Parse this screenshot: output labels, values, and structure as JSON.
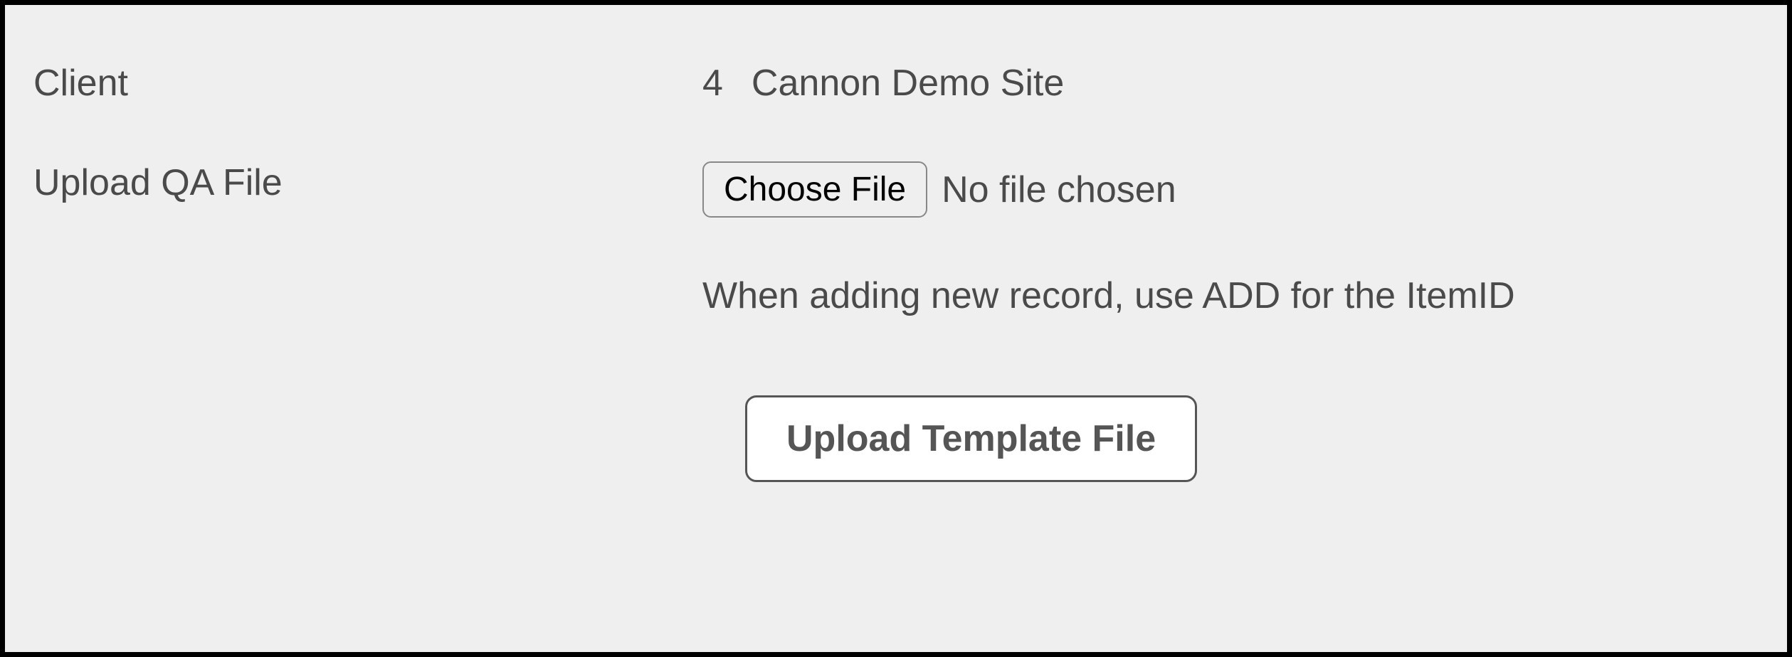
{
  "form": {
    "client_label": "Client",
    "client_id": "4",
    "client_name": "Cannon Demo Site",
    "upload_label": "Upload QA File",
    "choose_file_button": "Choose File",
    "file_status": "No file chosen",
    "hint": "When adding new record, use ADD for the ItemID",
    "upload_button": "Upload Template File"
  }
}
